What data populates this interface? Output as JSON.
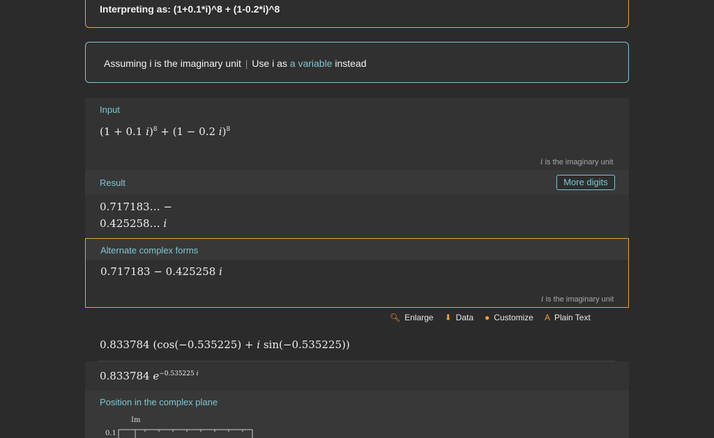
{
  "interpretation": {
    "prefix": "Interpreting as: ",
    "query": "(1+0.1*i)^8 + (1-0.2*i)^8"
  },
  "assumption": {
    "text": "Assuming i is the imaginary unit",
    "sep": "|",
    "use_text": "Use i as ",
    "link": "a variable",
    "suffix": " instead"
  },
  "input_pod": {
    "title": "Input",
    "expr_a": "(1 + 0.1 ",
    "i": "i",
    "close": ")",
    "exp": "8",
    "plus": " + ",
    "expr_b": "(1 − 0.2 ",
    "note_i": "i",
    "note": " is the imaginary unit"
  },
  "result_pod": {
    "title": "Result",
    "line1": "0.717183… −",
    "line2": "0.425258… ",
    "i": "i",
    "more_digits": "More digits"
  },
  "alt_pod": {
    "title": "Alternate complex forms",
    "rect": "0.717183 − 0.425258 ",
    "i": "i",
    "note_i": "i",
    "note": " is the imaginary unit",
    "polar": "0.833784 (cos(−0.535225) + ",
    "polar_mid": " sin(−0.535225))",
    "exp_base": "0.833784 ",
    "e": "e",
    "exp_power": "−0.535225 ",
    "exp_i": "i"
  },
  "toolbar": {
    "enlarge": "Enlarge",
    "data": "Data",
    "customize": "Customize",
    "plain_text": "Plain Text"
  },
  "plane_pod": {
    "title": "Position in the complex plane",
    "ylabel": "Im",
    "ytick": "0.1"
  }
}
